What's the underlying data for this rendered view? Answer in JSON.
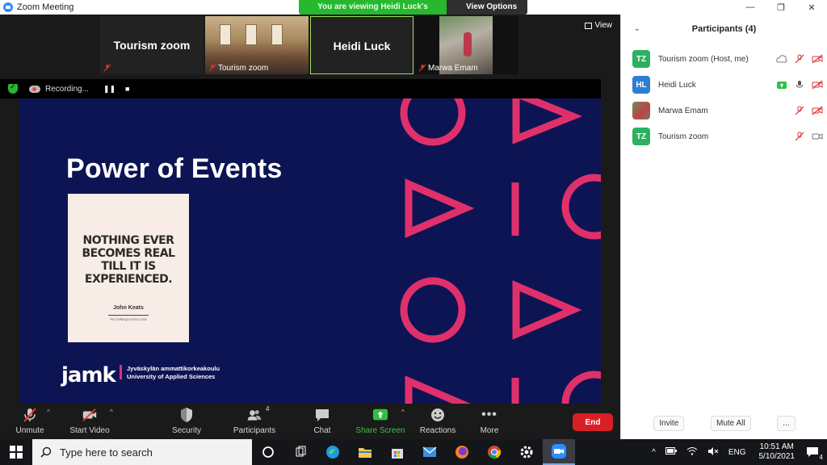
{
  "window": {
    "title": "Zoom Meeting",
    "minimize": "—",
    "restore": "❐",
    "close": "✕"
  },
  "banner": {
    "viewing_text": "You are viewing Heidi Luck's screen",
    "view_options": "View Options"
  },
  "thumbnails": [
    {
      "name": "Tourism zoom",
      "style": "name"
    },
    {
      "name": "Tourism zoom",
      "style": "video-room"
    },
    {
      "name": "Heidi Luck",
      "style": "name-active"
    },
    {
      "name": "Marwa Emam",
      "style": "video-outdoor"
    }
  ],
  "view_button": "View",
  "recording": {
    "label": "Recording...",
    "pause": "❚❚",
    "stop": "■"
  },
  "slide": {
    "title": "Power of Events",
    "quote_lines": [
      "NOTHING EVER",
      "BECOMES REAL",
      "TILL IT IS",
      "EXPERIENCED."
    ],
    "quote_author": "John Keats",
    "quote_site": "PICTUREQUOTES.COM",
    "logo": "jamk",
    "logo_sub_1": "Jyväskylän ammattikorkeakoulu",
    "logo_sub_2": "University of Applied Sciences",
    "accent": "#e0306b",
    "background": "#0d1453"
  },
  "toolbar": {
    "unmute": "Unmute",
    "start_video": "Start Video",
    "security": "Security",
    "participants": "Participants",
    "participants_count": "4",
    "chat": "Chat",
    "share_screen": "Share Screen",
    "reactions": "Reactions",
    "more": "More",
    "end": "End"
  },
  "panel": {
    "title": "Participants (4)",
    "participants": [
      {
        "initials": "TZ",
        "name": "Tourism zoom (Host, me)",
        "color": "#2bb15f"
      },
      {
        "initials": "HL",
        "name": "Heidi Luck",
        "color": "#2d7fd1"
      },
      {
        "initials": "",
        "name": "Marwa Emam",
        "color": ""
      },
      {
        "initials": "TZ",
        "name": "Tourism zoom",
        "color": "#2bb15f"
      }
    ],
    "invite": "Invite",
    "mute_all": "Mute All",
    "more": "..."
  },
  "taskbar": {
    "search_placeholder": "Type here to search",
    "time": "10:51 AM",
    "date": "5/10/2021",
    "lang": "ENG",
    "notification_count": "4"
  }
}
